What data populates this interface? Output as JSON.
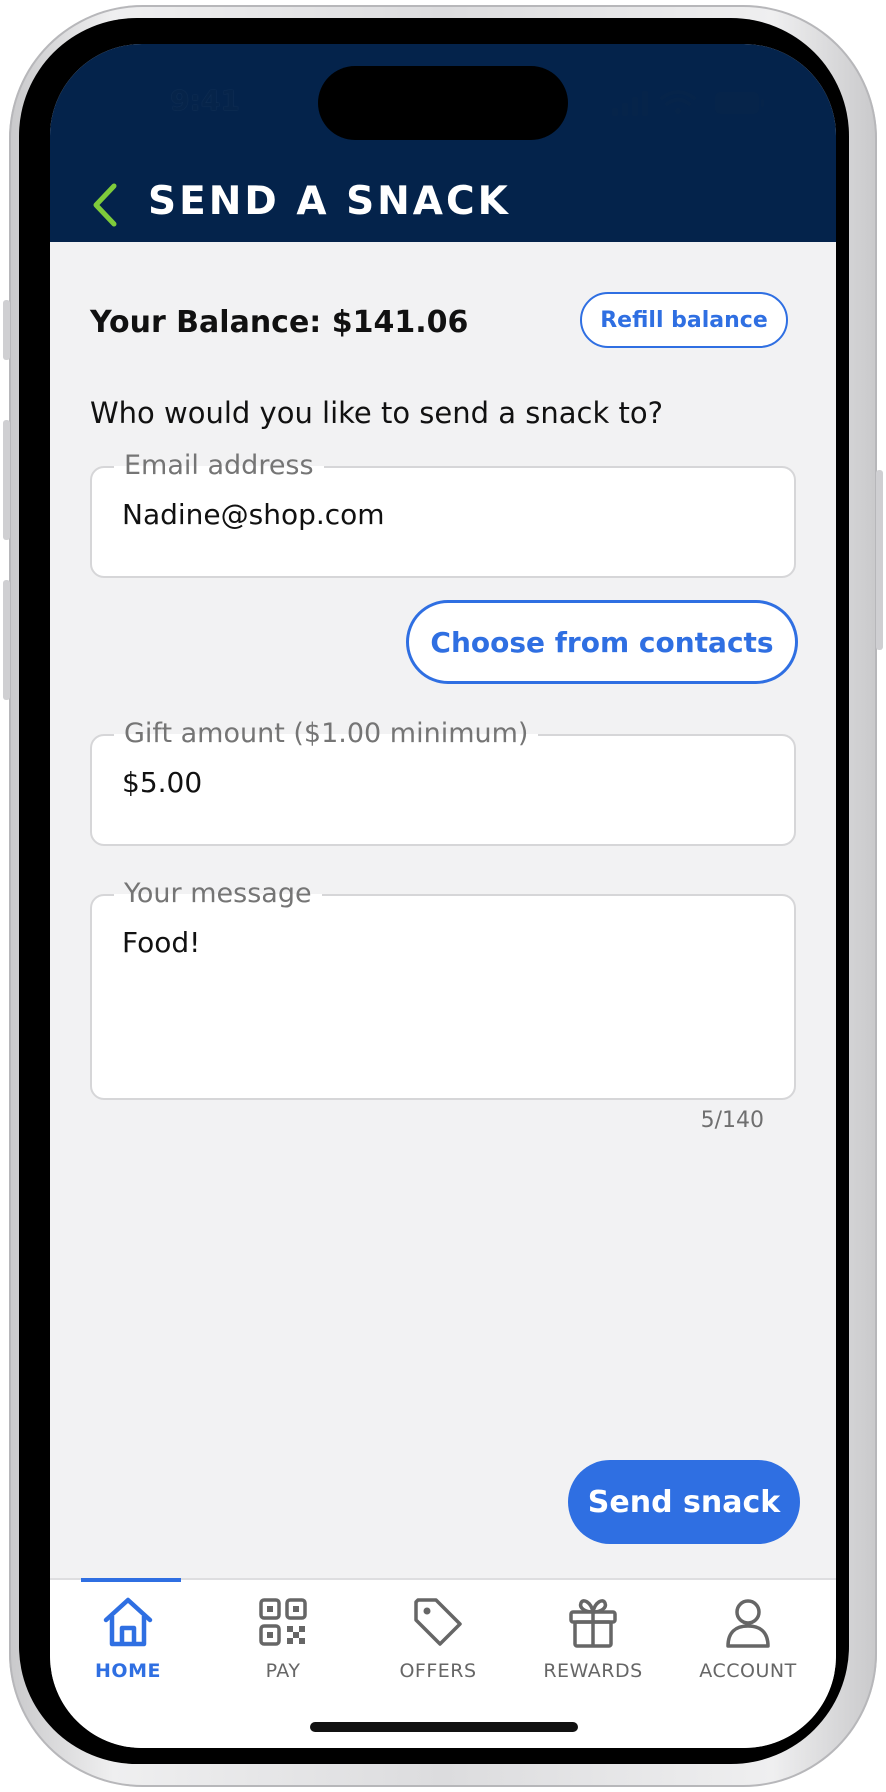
{
  "status_bar": {
    "time": "9:41"
  },
  "header": {
    "title": "SEND A SNACK",
    "back_icon": "chevron-left-icon"
  },
  "colors": {
    "header_bg": "#04234b",
    "accent": "#2f6fe2",
    "back_arrow": "#7ecb3b",
    "background": "#f2f2f3"
  },
  "balance": {
    "text": "Your Balance: $141.06",
    "refill_label": "Refill balance"
  },
  "form": {
    "question": "Who would you like to send a snack to?",
    "email": {
      "label": "Email address",
      "value": "Nadine@shop.com"
    },
    "contacts_label": "Choose from contacts",
    "amount": {
      "label": "Gift amount ($1.00 minimum)",
      "value": "$5.00"
    },
    "message": {
      "label": "Your message",
      "value": "Food!",
      "counter": "5/140"
    },
    "send_label": "Send snack"
  },
  "nav": {
    "items": [
      {
        "label": "HOME",
        "icon": "home-icon",
        "active": true
      },
      {
        "label": "PAY",
        "icon": "qr-code-icon",
        "active": false
      },
      {
        "label": "OFFERS",
        "icon": "tag-icon",
        "active": false
      },
      {
        "label": "REWARDS",
        "icon": "gift-icon",
        "active": false
      },
      {
        "label": "ACCOUNT",
        "icon": "user-icon",
        "active": false
      }
    ]
  }
}
